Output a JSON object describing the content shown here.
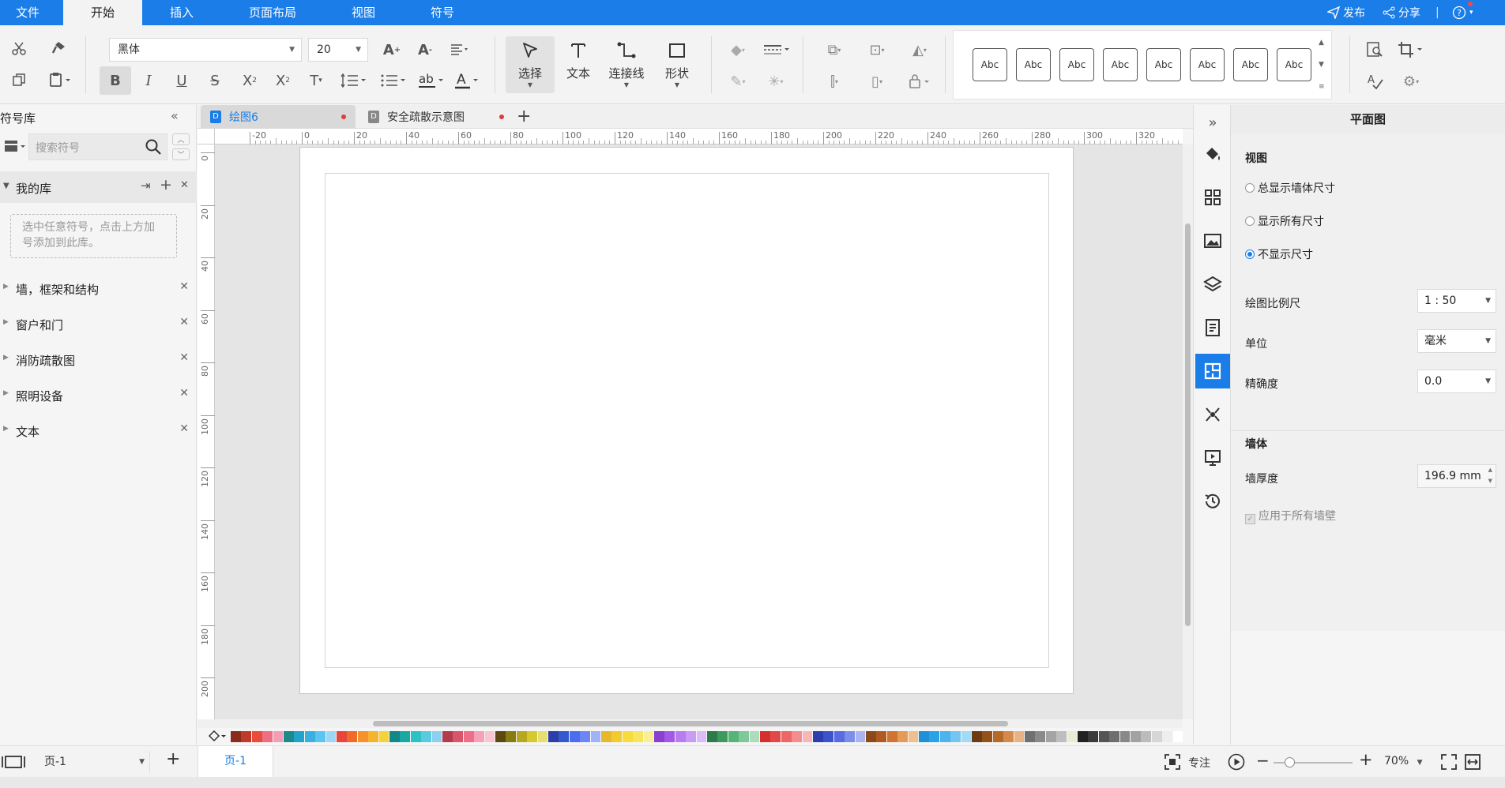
{
  "menubar": {
    "items": [
      "文件",
      "开始",
      "插入",
      "页面布局",
      "视图",
      "符号"
    ],
    "active": "开始",
    "publish": "发布",
    "share": "分享",
    "accent": "#1a7de8"
  },
  "toolbar": {
    "font_family": "黑体",
    "font_size": "20",
    "tools": {
      "select": "选择",
      "text": "文本",
      "connector": "连接线",
      "shape": "形状"
    },
    "style_label": "Abc"
  },
  "library": {
    "title": "符号库",
    "search_placeholder": "搜索符号",
    "my_library": "我的库",
    "my_library_hint": "选中任意符号，点击上方加号添加到此库。",
    "items": [
      "墙，框架和结构",
      "窗户和门",
      "消防疏散图",
      "照明设备",
      "文本"
    ]
  },
  "tabs": [
    {
      "label": "绘图6",
      "active": true
    },
    {
      "label": "安全疏散示意图",
      "active": false
    }
  ],
  "ruler": {
    "h": [
      "-20",
      "0",
      "20",
      "40",
      "60",
      "80",
      "100",
      "120",
      "140",
      "160",
      "180",
      "200",
      "220",
      "240",
      "260",
      "280",
      "300",
      "320"
    ],
    "v": [
      "0",
      "20",
      "40",
      "60",
      "80",
      "100",
      "120",
      "140",
      "160",
      "180",
      "200"
    ]
  },
  "properties": {
    "title": "平面图",
    "view_section": "视图",
    "view_options": [
      "总显示墙体尺寸",
      "显示所有尺寸",
      "不显示尺寸"
    ],
    "view_selected": "不显示尺寸",
    "scale_label": "绘图比例尺",
    "scale_value": "1 : 50",
    "unit_label": "单位",
    "unit_value": "毫米",
    "precision_label": "精确度",
    "precision_value": "0.0",
    "wall_section": "墙体",
    "wall_thickness_label": "墙厚度",
    "wall_thickness_value": "196.9 mm",
    "apply_all_label": "应用于所有墙壁"
  },
  "status": {
    "page_select": "页-1",
    "page_tab": "页-1",
    "focus": "专注",
    "zoom": "70%"
  },
  "palette_colors": [
    "#8b2b1c",
    "#c0392b",
    "#e74c3c",
    "#ec6f83",
    "#f29fb5",
    "#1b8a8a",
    "#23a3c9",
    "#3ab0e2",
    "#5bc5f1",
    "#9ad8f5",
    "#e8463a",
    "#f06a2a",
    "#f5922b",
    "#f5b42b",
    "#f4d23a",
    "#12888a",
    "#1aa9a2",
    "#2bc2c5",
    "#5cc9e2",
    "#8ad0ef",
    "#b23c4e",
    "#d9566a",
    "#ef6f88",
    "#f6a2b6",
    "#f8c6d2",
    "#5a4a12",
    "#8a7a12",
    "#b7a820",
    "#d6c92e",
    "#e7e070",
    "#2c3fa8",
    "#3557d0",
    "#4a6ef0",
    "#6c86f5",
    "#a0b2f8",
    "#e8b82b",
    "#f1cb2f",
    "#f6dc3c",
    "#f7e55f",
    "#f9ef97",
    "#8a3fd0",
    "#a358e6",
    "#b77cf0",
    "#c99bf5",
    "#dbbcf8",
    "#2e7a4a",
    "#3d9a5e",
    "#57b377",
    "#7ec99a",
    "#acdcbc",
    "#d62f2f",
    "#e34848",
    "#ee6666",
    "#f48e8e",
    "#f8b6b6",
    "#2d3fb0",
    "#3c53cc",
    "#566ce0",
    "#7d8ee8",
    "#a9b5f0",
    "#8a4a1c",
    "#b05a20",
    "#d27330",
    "#e59a58",
    "#f0bf8e",
    "#1f8fd6",
    "#2aa3e6",
    "#4ab4ec",
    "#73c6f0",
    "#a3dbf6",
    "#6e3c14",
    "#93521c",
    "#b76a28",
    "#d48a4c",
    "#e8b284",
    "#707070",
    "#8a8a8a",
    "#a4a4a4",
    "#bebebe",
    "#ececd4",
    "#222222",
    "#3a3a3a",
    "#545454",
    "#6e6e6e",
    "#888888",
    "#a2a2a2",
    "#bcbcbc",
    "#d6d6d6",
    "#eeeeee",
    "#ffffff"
  ]
}
